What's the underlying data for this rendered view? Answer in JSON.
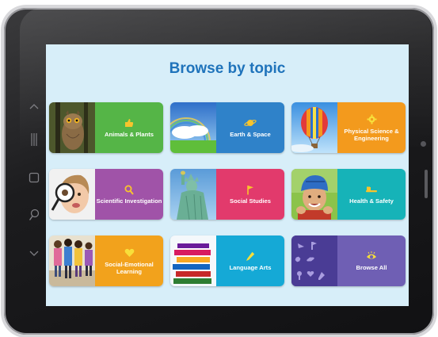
{
  "page": {
    "heading": "Browse by topic"
  },
  "colors": {
    "heading": "#1f73bb",
    "screen_bg": "#d7eef9"
  },
  "device_buttons": [
    {
      "name": "up-chevron-icon",
      "glyph": "^"
    },
    {
      "name": "recent-apps-icon",
      "glyph": "|||"
    },
    {
      "name": "home-square-icon",
      "glyph": "□"
    },
    {
      "name": "search-icon",
      "glyph": "⚲"
    },
    {
      "name": "down-chevron-icon",
      "glyph": "⌄"
    }
  ],
  "topics": [
    {
      "label": "Animals & Plants",
      "color": "#55b547",
      "icon": "thumbs-up-icon"
    },
    {
      "label": "Earth & Space",
      "color": "#2f82c9",
      "icon": "planet-icon"
    },
    {
      "label": "Physical Science & Engineering",
      "color": "#f39a1d",
      "icon": "gear-icon"
    },
    {
      "label": "Scientific Investigation",
      "color": "#a053a8",
      "icon": "magnifier-icon"
    },
    {
      "label": "Social Studies",
      "color": "#e23a6c",
      "icon": "flag-icon"
    },
    {
      "label": "Health & Safety",
      "color": "#16b3b8",
      "icon": "toothbrush-icon"
    },
    {
      "label": "Social-Emotional Learning",
      "color": "#f2a21c",
      "icon": "heart-icon"
    },
    {
      "label": "Language Arts",
      "color": "#15a9d6",
      "icon": "pencil-icon"
    },
    {
      "label": "Browse All",
      "color": "#6f5fb4",
      "icon": "eye-icon"
    }
  ]
}
